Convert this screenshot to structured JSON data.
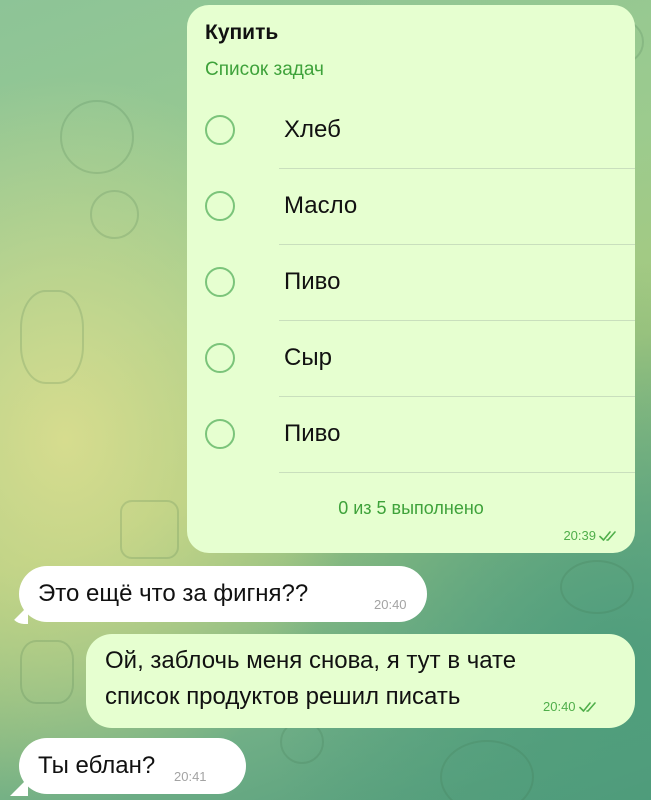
{
  "checklist": {
    "title": "Купить",
    "subtitle": "Список задач",
    "items": [
      {
        "label": "Хлеб",
        "done": false
      },
      {
        "label": "Масло",
        "done": false
      },
      {
        "label": "Пиво",
        "done": false
      },
      {
        "label": "Сыр",
        "done": false
      },
      {
        "label": "Пиво",
        "done": false
      }
    ],
    "progress": "0 из 5 выполнено",
    "time": "20:39"
  },
  "messages": [
    {
      "direction": "incoming",
      "text": "Это ещё что за фигня??",
      "time": "20:40"
    },
    {
      "direction": "outgoing",
      "line1": "Ой, заблочь меня снова, я тут в чате",
      "line2": "список продуктов решил писать",
      "time": "20:40"
    },
    {
      "direction": "incoming",
      "text": "Ты еблан?",
      "time": "20:41"
    }
  ],
  "colors": {
    "outgoing_bubble": "#e6ffd0",
    "incoming_bubble": "#ffffff",
    "accent_green": "#3ea23a",
    "read_check": "#4fae4a"
  },
  "icons": {
    "read_receipt": "double-check-icon",
    "task_checkbox": "empty-circle-icon"
  }
}
